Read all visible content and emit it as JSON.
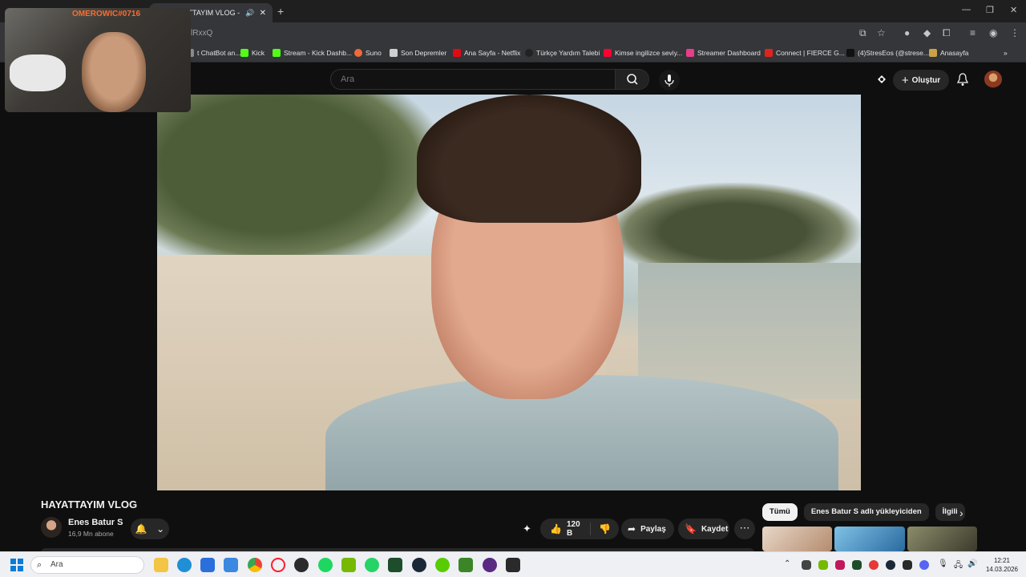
{
  "browser": {
    "tab_title": "HAYATTAYIM VLOG - YouTube",
    "omnibox_value": "lRxxQ",
    "bookmarks": [
      {
        "label": "t ChatBot an...",
        "color": "#8a8a8a"
      },
      {
        "label": "Kick",
        "color": "#53fc18"
      },
      {
        "label": "Stream - Kick Dashb...",
        "color": "#53fc18"
      },
      {
        "label": "Suno",
        "color": "#f06a3a"
      },
      {
        "label": "Son Depremler",
        "color": "#cfcfcf"
      },
      {
        "label": "Ana Sayfa - Netflix",
        "color": "#e50914"
      },
      {
        "label": "Türkçe Yardım Talebi",
        "color": "#222222"
      },
      {
        "label": "Kimse ingilizce seviy...",
        "color": "#ff0033"
      },
      {
        "label": "Streamer Dashboard",
        "color": "#e63e8a"
      },
      {
        "label": "Connect | FIERCE G...",
        "color": "#e0241c"
      },
      {
        "label": "(4)StresEos (@strese...",
        "color": "#111111"
      },
      {
        "label": "Anasayfa",
        "color": "#c9a24a"
      }
    ]
  },
  "youtube": {
    "search_placeholder": "Ara",
    "create_label": "Oluştur"
  },
  "webcam": {
    "streamer_name": "OMEROWIC#0716"
  },
  "video": {
    "title": "HAYATTAYIM VLOG",
    "channel_name": "Enes Batur S",
    "subscribers": "16,9 Mn abone",
    "likes": "120 B",
    "share_label": "Paylaş",
    "save_label": "Kaydet"
  },
  "chips": [
    "Tümü",
    "Enes Batur S adlı yükleyiciden",
    "İlgili"
  ],
  "taskbar": {
    "search_placeholder": "Ara",
    "time": "12:21",
    "date": "14.03.2026"
  }
}
